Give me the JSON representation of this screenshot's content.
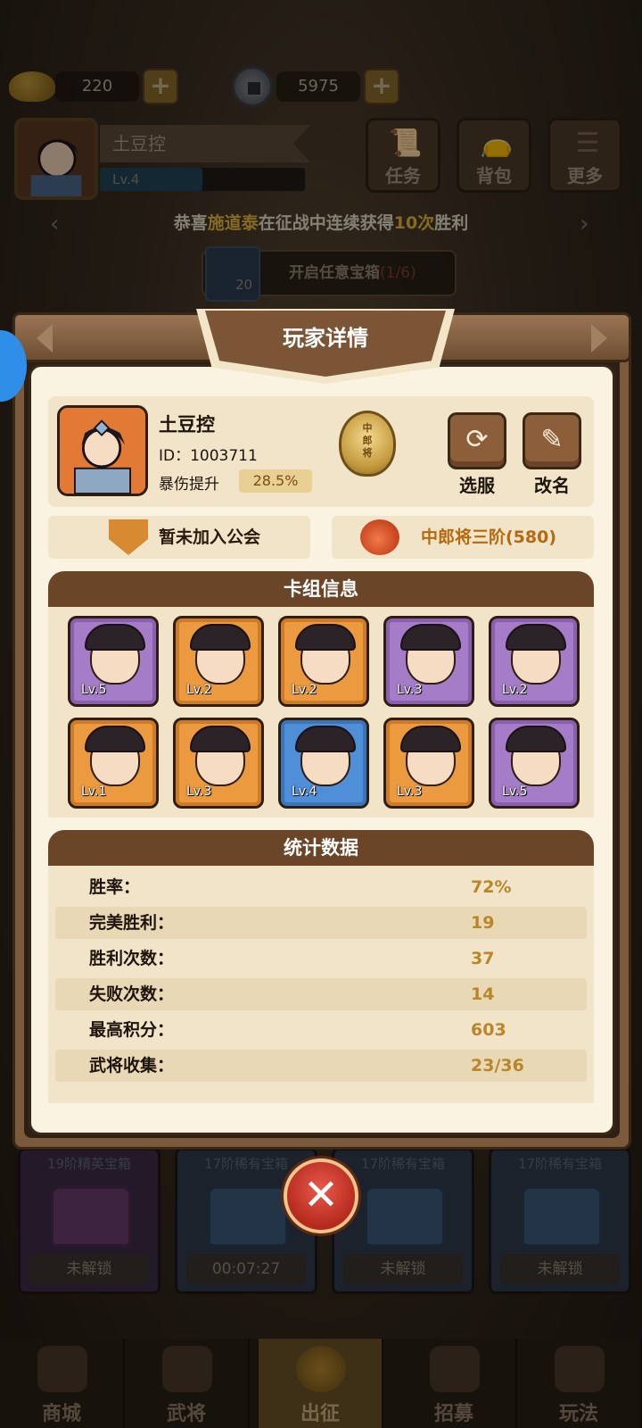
{
  "currency": {
    "gold": "220",
    "coins": "5975"
  },
  "player_header": {
    "name": "土豆控",
    "level": "Lv.4",
    "level_progress": 0.5
  },
  "top_buttons": [
    {
      "label": "任务"
    },
    {
      "label": "背包"
    },
    {
      "label": "更多"
    }
  ],
  "marquee": {
    "prefix": "恭喜",
    "player": "施道泰",
    "middle": "在征战中连续获得",
    "count": "10次",
    "suffix": "胜利"
  },
  "chest_task": {
    "count": "20",
    "text": "开启任意宝箱",
    "progress": "(1/6)"
  },
  "modal": {
    "title": "玩家详情",
    "player": {
      "name": "土豆控",
      "id": "ID：1003711",
      "crit_label": "暴伤提升",
      "crit_value": "28.5%"
    },
    "rank_badge": "中郎将",
    "buttons": {
      "switch_server": "选服",
      "rename": "改名"
    },
    "guild": "暂未加入公会",
    "rank": "中郎将三阶(580)",
    "deck": {
      "title": "卡组信息",
      "cards": [
        {
          "level": "Lv.5",
          "rarity": "purple"
        },
        {
          "level": "Lv.2",
          "rarity": "orange"
        },
        {
          "level": "Lv.2",
          "rarity": "orange"
        },
        {
          "level": "Lv.3",
          "rarity": "purple"
        },
        {
          "level": "Lv.2",
          "rarity": "purple"
        },
        {
          "level": "Lv.1",
          "rarity": "orange"
        },
        {
          "level": "Lv.3",
          "rarity": "orange"
        },
        {
          "level": "Lv.4",
          "rarity": "blue"
        },
        {
          "level": "Lv.3",
          "rarity": "orange"
        },
        {
          "level": "Lv.5",
          "rarity": "purple"
        }
      ]
    },
    "stats": {
      "title": "统计数据",
      "rows": [
        {
          "label": "胜率：",
          "value": "72%"
        },
        {
          "label": "完美胜利：",
          "value": "19"
        },
        {
          "label": "胜利次数：",
          "value": "37"
        },
        {
          "label": "失败次数：",
          "value": "14"
        },
        {
          "label": "最高积分：",
          "value": "603"
        },
        {
          "label": "武将收集：",
          "value": "23/36"
        }
      ]
    }
  },
  "chests": [
    {
      "title": "19阶精英宝箱",
      "status": "未解锁",
      "color": "purple"
    },
    {
      "title": "17阶稀有宝箱",
      "status": "00:07:27",
      "color": "blue"
    },
    {
      "title": "17阶稀有宝箱",
      "status": "未解锁",
      "color": "blue"
    },
    {
      "title": "17阶稀有宝箱",
      "status": "未解锁",
      "color": "blue"
    }
  ],
  "bottom_nav": [
    {
      "label": "商城"
    },
    {
      "label": "武将"
    },
    {
      "label": "出征"
    },
    {
      "label": "招募"
    },
    {
      "label": "玩法"
    }
  ]
}
